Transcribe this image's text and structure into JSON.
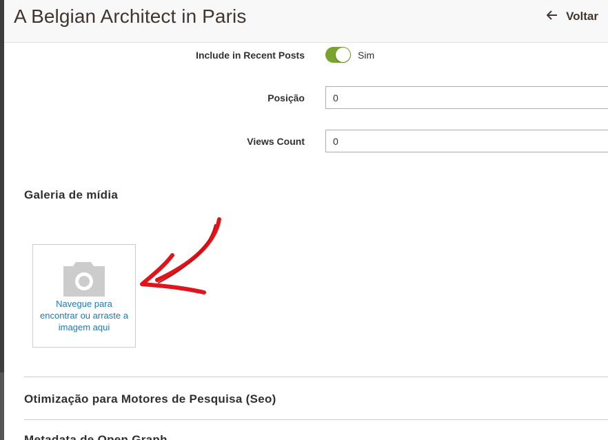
{
  "header": {
    "title": "A Belgian Architect in Paris",
    "back_label": "Voltar"
  },
  "form": {
    "recent_posts": {
      "label": "Include in Recent Posts",
      "toggle_value": "Sim",
      "enabled": true
    },
    "position": {
      "label": "Posição",
      "value": "0"
    },
    "views_count": {
      "label": "Views Count",
      "value": "0"
    }
  },
  "gallery": {
    "title": "Galeria de mídia",
    "upload_text": "Navegue para encontrar ou arraste a imagem aqui"
  },
  "sections": {
    "seo": "Otimização para Motores de Pesquisa (Seo)",
    "open_graph": "Metadata de Open Graph"
  },
  "colors": {
    "toggle_on": "#79a22e",
    "link": "#1979c3",
    "annotation_arrow": "#e0141b"
  },
  "icons": [
    "arrow-left-icon",
    "camera-icon",
    "red-arrow-annotation"
  ]
}
